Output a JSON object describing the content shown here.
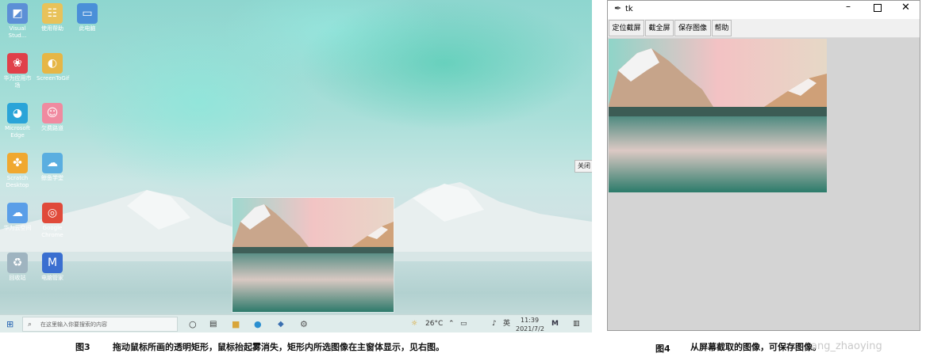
{
  "desktop": {
    "icons": [
      {
        "label": "Visual Stud...",
        "icon": "visual-studio-icon",
        "color": "#5c8fd6"
      },
      {
        "label": "使用帮助",
        "icon": "help-doc-icon",
        "color": "#e8c25a"
      },
      {
        "label": "此电脑",
        "icon": "computer-icon",
        "color": "#4a8fd8"
      },
      {
        "label": "华为应用市场",
        "icon": "huawei-appgallery-icon",
        "color": "#e0404a"
      },
      {
        "label": "ScreenToGif",
        "icon": "screentogif-icon",
        "color": "#e6b646"
      },
      {
        "label": "Microsoft Edge",
        "icon": "edge-icon",
        "color": "#2aa4d8"
      },
      {
        "label": "欠费路道",
        "icon": "app-cartoon-icon",
        "color": "#f08aa0"
      },
      {
        "label": "Scratch Desktop",
        "icon": "scratch-icon",
        "color": "#f0a830"
      },
      {
        "label": "鲸鱼学堂",
        "icon": "whale-icon",
        "color": "#5aaee0"
      },
      {
        "label": "华为云空间",
        "icon": "huawei-cloud-icon",
        "color": "#5a9ee8"
      },
      {
        "label": "Google Chrome",
        "icon": "chrome-icon",
        "color": "#e04a3a"
      },
      {
        "label": "回收站",
        "icon": "recycle-bin-icon",
        "color": "#9fb4c0"
      },
      {
        "label": "电脑管家",
        "icon": "pc-manager-icon",
        "color": "#3a6fd0"
      }
    ],
    "close_label": "关闭",
    "taskbar": {
      "search_placeholder": "在这里输入你要搜索的内容",
      "weather": "26°C",
      "ime": "英",
      "time": "11:39",
      "date": "2021/7/2"
    }
  },
  "tk_window": {
    "title": "tk",
    "menu": [
      "定位截屏",
      "截全屏",
      "保存图像",
      "帮助"
    ]
  },
  "captions": {
    "fig3_label": "图3",
    "fig3_text": "拖动鼠标所画的透明矩形，鼠标抬起雾消失，矩形内所选图像在主窗体显示，见右图。",
    "fig4_label": "图4",
    "fig4_text": "从屏幕截取的图像，可保存图像。",
    "watermark": "ang_zhaoying"
  }
}
